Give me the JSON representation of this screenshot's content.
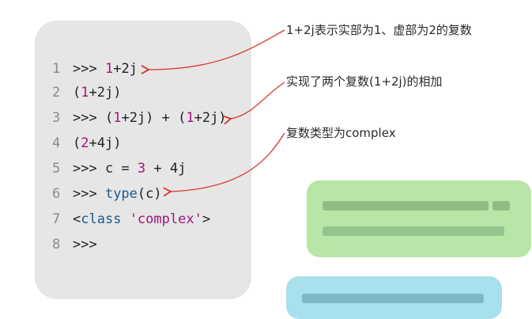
{
  "code": {
    "lines": [
      {
        "n": "1",
        "prompt": ">>> ",
        "parts": [
          {
            "t": "1",
            "c": "num"
          },
          {
            "t": "+2j",
            "c": ""
          }
        ]
      },
      {
        "n": "2",
        "prompt": "",
        "parts": [
          {
            "t": "(",
            "c": ""
          },
          {
            "t": "1",
            "c": "num"
          },
          {
            "t": "+2j)",
            "c": ""
          }
        ]
      },
      {
        "n": "3",
        "prompt": ">>> ",
        "parts": [
          {
            "t": "(",
            "c": ""
          },
          {
            "t": "1",
            "c": "num"
          },
          {
            "t": "+2j) + (",
            "c": ""
          },
          {
            "t": "1",
            "c": "num"
          },
          {
            "t": "+2j)",
            "c": ""
          }
        ]
      },
      {
        "n": "4",
        "prompt": "",
        "parts": [
          {
            "t": "(",
            "c": ""
          },
          {
            "t": "2",
            "c": "num"
          },
          {
            "t": "+4j)",
            "c": ""
          }
        ]
      },
      {
        "n": "5",
        "prompt": ">>> ",
        "parts": [
          {
            "t": "c = ",
            "c": ""
          },
          {
            "t": "3",
            "c": "num"
          },
          {
            "t": " + 4j",
            "c": ""
          }
        ]
      },
      {
        "n": "6",
        "prompt": ">>> ",
        "parts": [
          {
            "t": "type",
            "c": "kw"
          },
          {
            "t": "(c)",
            "c": ""
          }
        ]
      },
      {
        "n": "7",
        "prompt": "",
        "parts": [
          {
            "t": "<",
            "c": ""
          },
          {
            "t": "class",
            "c": "kw"
          },
          {
            "t": " ",
            "c": ""
          },
          {
            "t": "'complex'",
            "c": "str"
          },
          {
            "t": ">",
            "c": ""
          }
        ]
      },
      {
        "n": "8",
        "prompt": ">>>",
        "parts": []
      }
    ]
  },
  "annotations": {
    "a1": "1+2j表示实部为1、虚部为2的复数",
    "a2": "实现了两个复数(1+2j)的相加",
    "a3": "复数类型为complex"
  },
  "colors": {
    "arrow": "#d9362b",
    "panel": "#e6e6e6",
    "blur_green": "#b8e6a6",
    "blur_blue": "#a9e0ee"
  }
}
